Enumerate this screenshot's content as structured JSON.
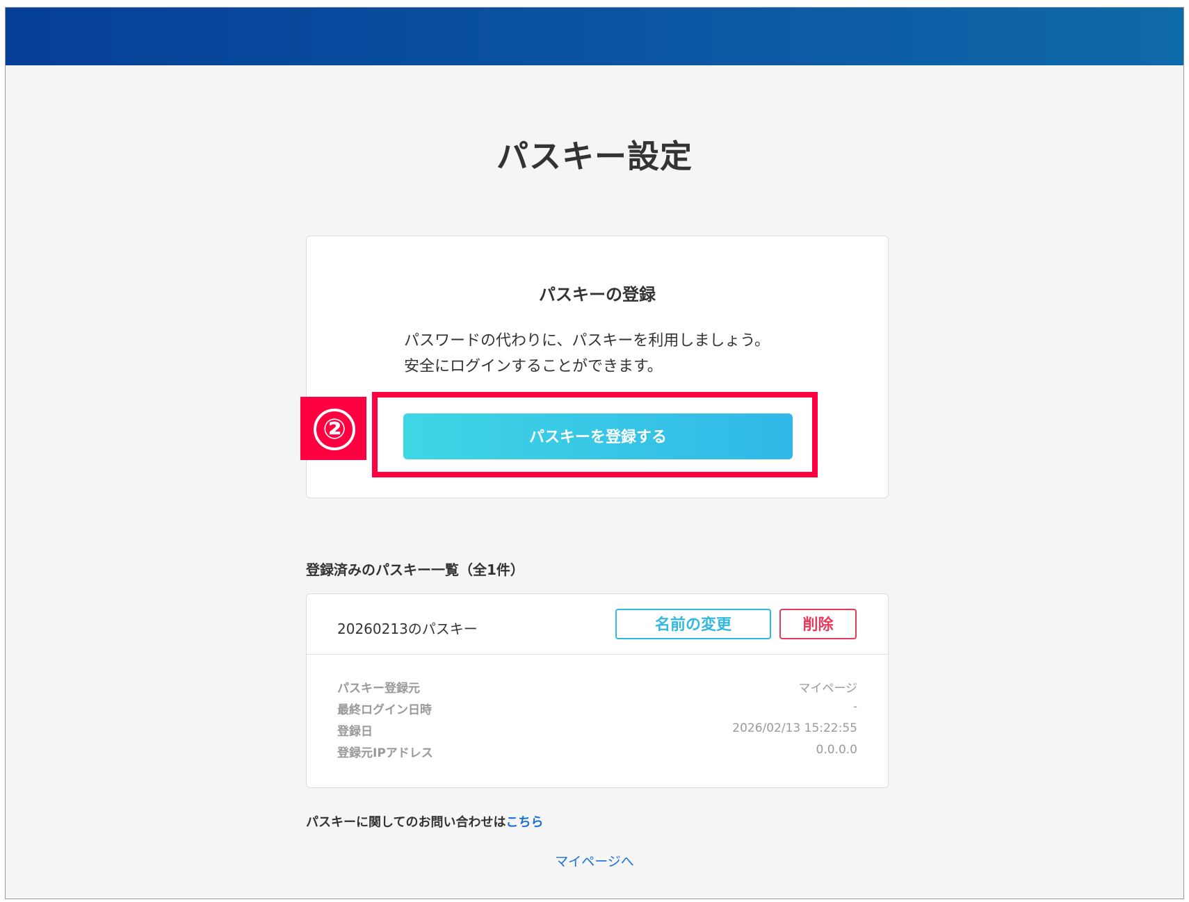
{
  "page": {
    "title": "パスキー設定"
  },
  "register_section": {
    "title": "パスキーの登録",
    "description_line1": "パスワードの代わりに、パスキーを利用しましょう。",
    "description_line2": "安全にログインすることができます。",
    "button_label": "パスキーを登録する"
  },
  "annotation": {
    "step_number": "②",
    "color": "#ff0040"
  },
  "passkey_list": {
    "heading": "登録済みのパスキー一覧（全1件）",
    "items": [
      {
        "name": "20260213のパスキー",
        "rename_label": "名前の変更",
        "delete_label": "削除",
        "details": [
          {
            "label": "パスキー登録元",
            "value": "マイページ"
          },
          {
            "label": "最終ログイン日時",
            "value": "-"
          },
          {
            "label": "登録日",
            "value": "2026/02/13 15:22:55"
          },
          {
            "label": "登録元IPアドレス",
            "value": "0.0.0.0"
          }
        ]
      }
    ]
  },
  "footer": {
    "inquiry_text": "パスキーに関してのお問い合わせは",
    "inquiry_link": "こちら",
    "mypage_link": "マイページへ"
  },
  "colors": {
    "header_gradient_start": "#053f98",
    "header_gradient_end": "#0f6aa9",
    "primary_button": "#30b8e8",
    "delete_accent": "#e63a5c",
    "link": "#1a70d6",
    "background": "#f5f5f5"
  }
}
